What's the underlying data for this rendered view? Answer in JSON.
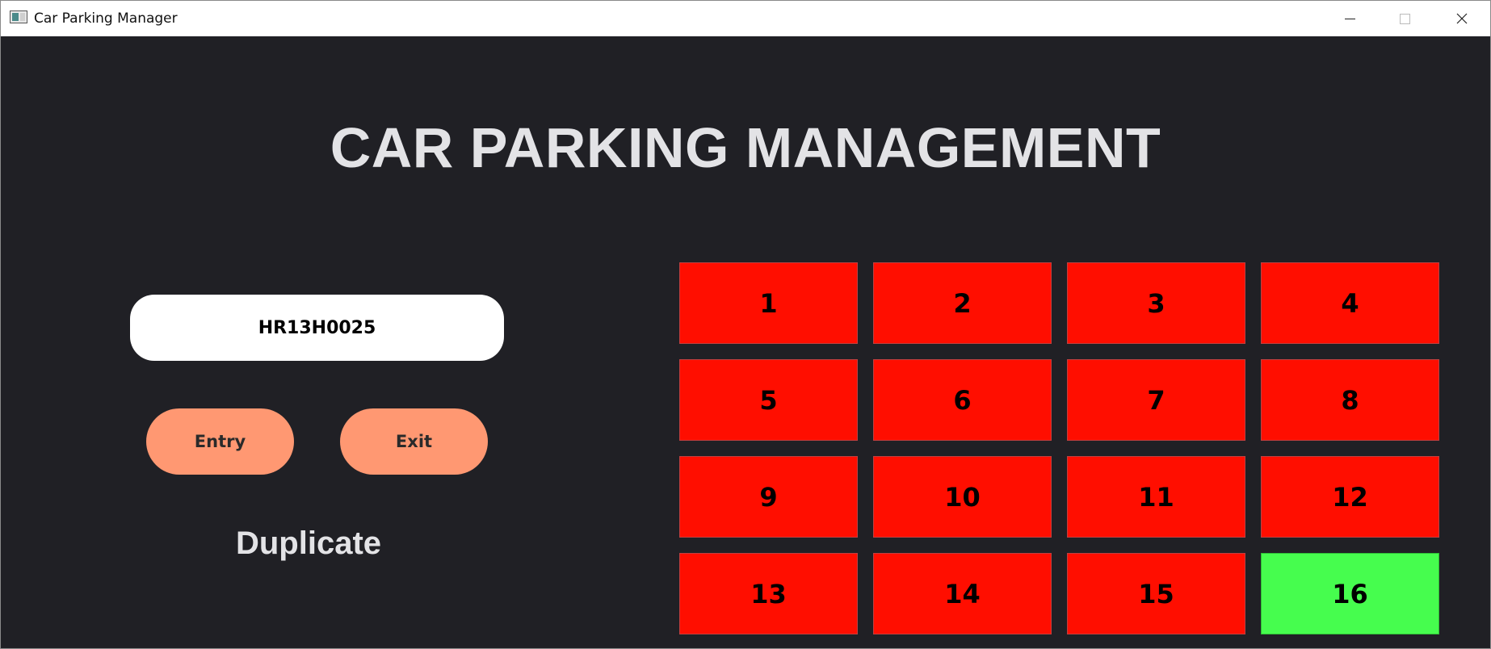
{
  "window": {
    "title": "Car Parking Manager"
  },
  "heading": "CAR PARKING MANAGEMENT",
  "plate_input": {
    "value": "HR13H0025"
  },
  "buttons": {
    "entry_label": "Entry",
    "exit_label": "Exit"
  },
  "status_message": "Duplicate",
  "colors": {
    "background": "#202025",
    "occupied": "#ff0e00",
    "free": "#46fd4e",
    "button": "#ff9872"
  },
  "slots": [
    {
      "label": "1",
      "status": "occupied"
    },
    {
      "label": "2",
      "status": "occupied"
    },
    {
      "label": "3",
      "status": "occupied"
    },
    {
      "label": "4",
      "status": "occupied"
    },
    {
      "label": "5",
      "status": "occupied"
    },
    {
      "label": "6",
      "status": "occupied"
    },
    {
      "label": "7",
      "status": "occupied"
    },
    {
      "label": "8",
      "status": "occupied"
    },
    {
      "label": "9",
      "status": "occupied"
    },
    {
      "label": "10",
      "status": "occupied"
    },
    {
      "label": "11",
      "status": "occupied"
    },
    {
      "label": "12",
      "status": "occupied"
    },
    {
      "label": "13",
      "status": "occupied"
    },
    {
      "label": "14",
      "status": "occupied"
    },
    {
      "label": "15",
      "status": "occupied"
    },
    {
      "label": "16",
      "status": "free"
    }
  ],
  "icons": {
    "app": "app-window-icon",
    "minimize": "minimize-icon",
    "maximize": "maximize-icon",
    "close": "close-icon"
  }
}
